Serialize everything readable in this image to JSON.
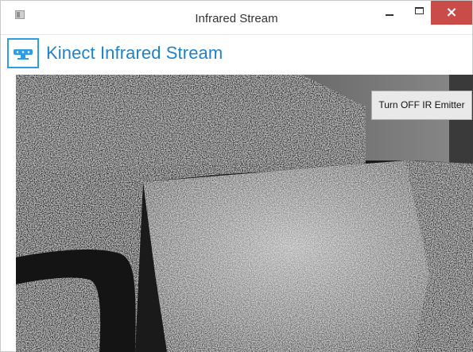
{
  "window": {
    "title": "Infrared Stream",
    "close_glyph": "×",
    "icons": [
      "app-icon",
      "minimize-icon",
      "maximize-icon",
      "close-icon"
    ]
  },
  "header": {
    "title": "Kinect Infrared Stream",
    "logo_icon": "kinect-sensor-icon",
    "accent_color": "#1e83cc"
  },
  "stream": {
    "type": "infrared-camera-feed",
    "toggle_button_label": "Turn OFF IR Emitter"
  }
}
